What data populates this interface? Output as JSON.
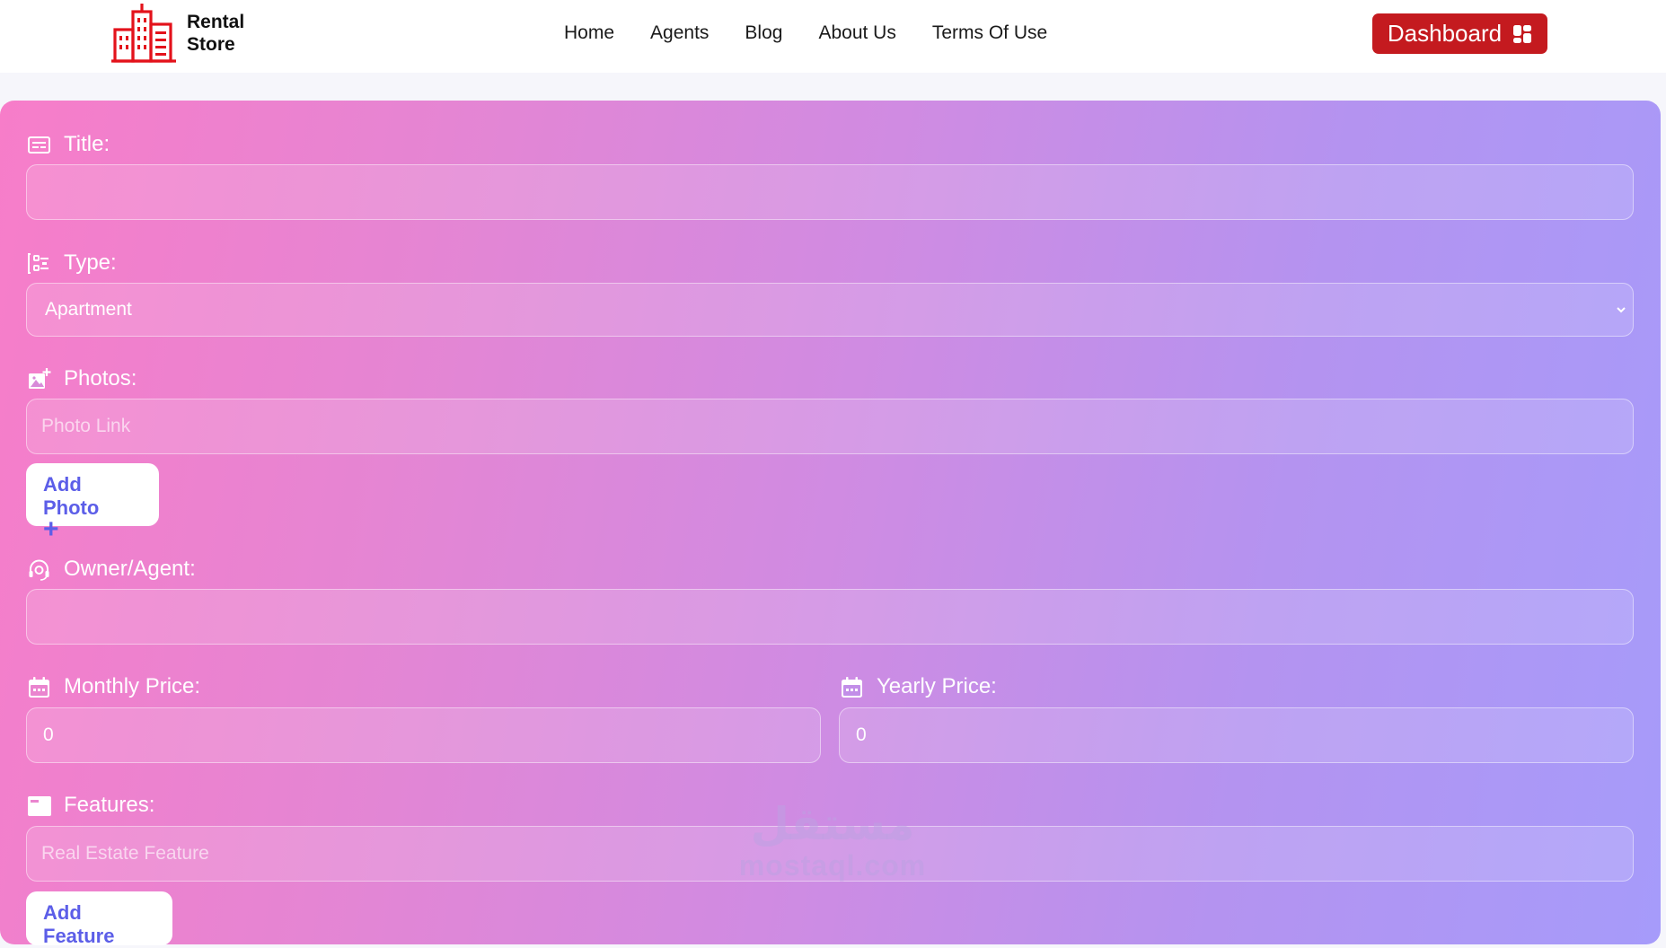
{
  "header": {
    "brand_line1": "Rental",
    "brand_line2": "Store",
    "nav": [
      "Home",
      "Agents",
      "Blog",
      "About Us",
      "Terms Of Use"
    ],
    "dashboard_label": "Dashboard",
    "brand_color": "#c41a1f",
    "logo_icon": "buildings-icon",
    "dashboard_icon": "grid-icon"
  },
  "form": {
    "title_label": "Title:",
    "title_value": "",
    "type_label": "Type:",
    "type_value": "Apartment",
    "photos_label": "Photos:",
    "photo_placeholder": "Photo Link",
    "add_photo_label": "Add Photo",
    "add_photo_plus": "+",
    "owner_label": "Owner/Agent:",
    "owner_value": "",
    "monthly_label": "Monthly Price:",
    "monthly_value": "0",
    "yearly_label": "Yearly Price:",
    "yearly_value": "0",
    "features_label": "Features:",
    "feature_placeholder": "Real Estate Feature",
    "add_feature_label": "Add Feature",
    "gradient_start": "#f77dc9",
    "gradient_end": "#a69bfa",
    "accent_button_text": "#5c5ee8"
  },
  "watermark": {
    "arabic": "مستقل",
    "latin": "mostaql.com"
  }
}
